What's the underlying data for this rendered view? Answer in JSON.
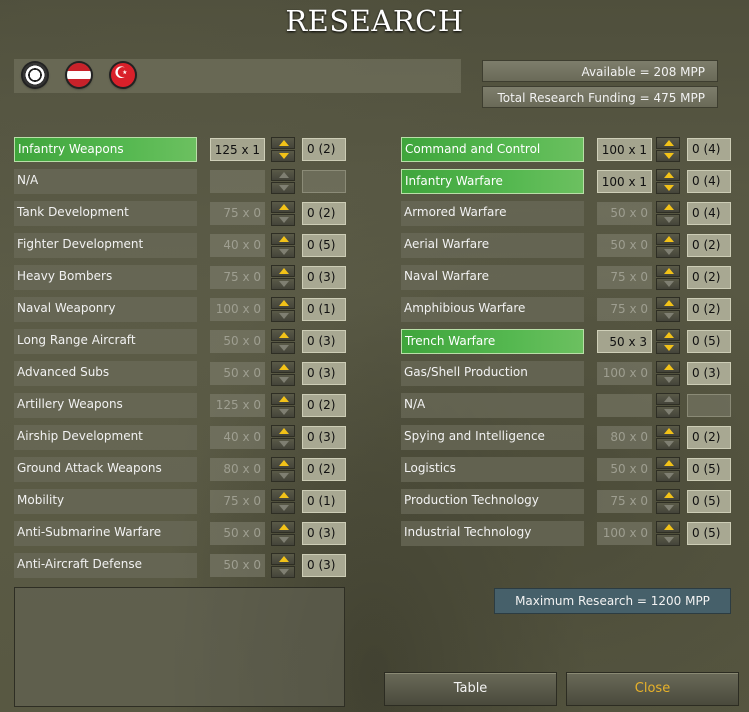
{
  "title": "RESEARCH",
  "nations": [
    {
      "name": "germany-flag-icon"
    },
    {
      "name": "austria-hungary-flag-icon"
    },
    {
      "name": "turkey-flag-icon"
    }
  ],
  "available": "Available = 208 MPP",
  "total_funding": "Total Research Funding = 475 MPP",
  "left_column": [
    {
      "label": "Infantry Weapons",
      "cost": "125 x 1",
      "level": "0 (2)",
      "active": true,
      "can_dec": true
    },
    {
      "label": "N/A",
      "cost": "",
      "level": "",
      "active": false,
      "blank": true
    },
    {
      "label": "Tank Development",
      "cost": "75 x 0",
      "level": "0 (2)",
      "active": false
    },
    {
      "label": "Fighter Development",
      "cost": "40 x 0",
      "level": "0 (5)",
      "active": false
    },
    {
      "label": "Heavy Bombers",
      "cost": "75 x 0",
      "level": "0 (3)",
      "active": false
    },
    {
      "label": "Naval Weaponry",
      "cost": "100 x 0",
      "level": "0 (1)",
      "active": false
    },
    {
      "label": "Long Range Aircraft",
      "cost": "50 x 0",
      "level": "0 (3)",
      "active": false
    },
    {
      "label": "Advanced Subs",
      "cost": "50 x 0",
      "level": "0 (3)",
      "active": false
    },
    {
      "label": "Artillery Weapons",
      "cost": "125 x 0",
      "level": "0 (2)",
      "active": false
    },
    {
      "label": "Airship Development",
      "cost": "40 x 0",
      "level": "0 (3)",
      "active": false
    },
    {
      "label": "Ground Attack Weapons",
      "cost": "80 x 0",
      "level": "0 (2)",
      "active": false
    },
    {
      "label": "Mobility",
      "cost": "75 x 0",
      "level": "0 (1)",
      "active": false
    },
    {
      "label": "Anti-Submarine Warfare",
      "cost": "50 x 0",
      "level": "0 (3)",
      "active": false
    },
    {
      "label": "Anti-Aircraft Defense",
      "cost": "50 x 0",
      "level": "0 (3)",
      "active": false
    }
  ],
  "right_column": [
    {
      "label": "Command and Control",
      "cost": "100 x 1",
      "level": "0 (4)",
      "active": true,
      "can_dec": true
    },
    {
      "label": "Infantry Warfare",
      "cost": "100 x 1",
      "level": "0 (4)",
      "active": true,
      "can_dec": true
    },
    {
      "label": "Armored Warfare",
      "cost": "50 x 0",
      "level": "0 (4)",
      "active": false
    },
    {
      "label": "Aerial Warfare",
      "cost": "50 x 0",
      "level": "0 (2)",
      "active": false
    },
    {
      "label": "Naval Warfare",
      "cost": "75 x 0",
      "level": "0 (2)",
      "active": false
    },
    {
      "label": "Amphibious Warfare",
      "cost": "75 x 0",
      "level": "0 (2)",
      "active": false
    },
    {
      "label": "Trench Warfare",
      "cost": "50 x 3",
      "level": "0 (5)",
      "active": true,
      "can_dec": true
    },
    {
      "label": "Gas/Shell Production",
      "cost": "100 x 0",
      "level": "0 (3)",
      "active": false
    },
    {
      "label": "N/A",
      "cost": "",
      "level": "",
      "active": false,
      "blank": true
    },
    {
      "label": "Spying and Intelligence",
      "cost": "80 x 0",
      "level": "0 (2)",
      "active": false
    },
    {
      "label": "Logistics",
      "cost": "50 x 0",
      "level": "0 (5)",
      "active": false
    },
    {
      "label": "Production Technology",
      "cost": "75 x 0",
      "level": "0 (5)",
      "active": false
    },
    {
      "label": "Industrial Technology",
      "cost": "100 x 0",
      "level": "0 (5)",
      "active": false
    }
  ],
  "maximum_research": "Maximum Research = 1200 MPP",
  "description": "",
  "buttons": {
    "table": "Table",
    "close": "Close"
  }
}
